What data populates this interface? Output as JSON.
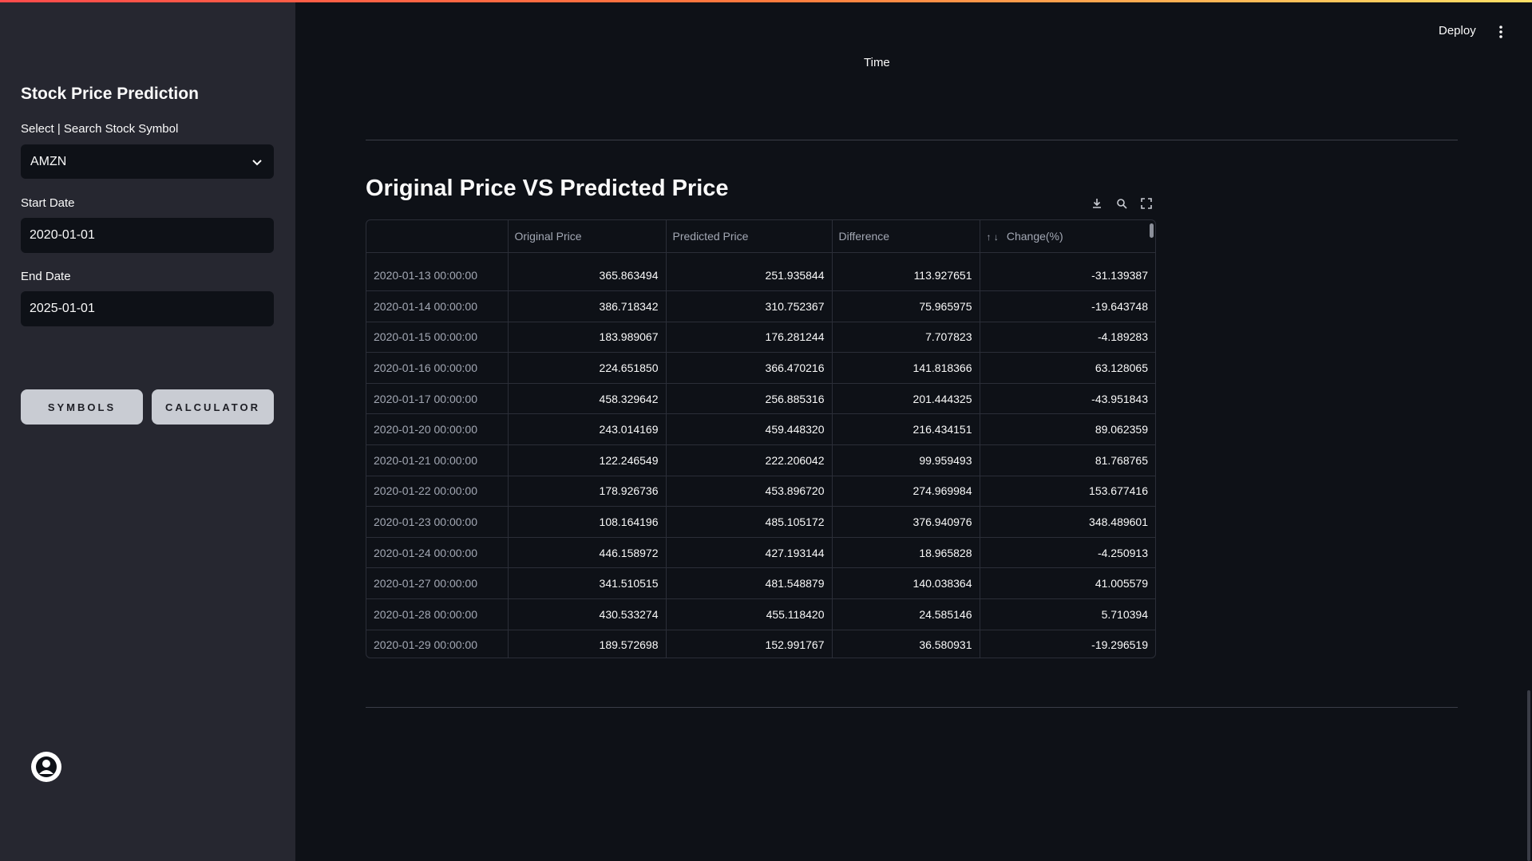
{
  "header": {
    "deploy_label": "Deploy",
    "menu_icon": "kebab-menu-icon"
  },
  "sidebar": {
    "title": "Stock Price Prediction",
    "symbol_label": "Select | Search Stock Symbol",
    "symbol_value": "AMZN",
    "start_date_label": "Start Date",
    "start_date_value": "2020-01-01",
    "end_date_label": "End Date",
    "end_date_value": "2025-01-01",
    "symbols_button": "SYMBOLS",
    "calculator_button": "CALCULATOR",
    "avatar_icon": "user-avatar-icon"
  },
  "main": {
    "axis_label": "Time",
    "section_title": "Original Price VS Predicted Price",
    "toolbar_icons": [
      "download-icon",
      "search-icon",
      "fullscreen-icon"
    ],
    "table": {
      "columns": [
        "",
        "Original Price",
        "Predicted Price",
        "Difference",
        "Change(%)"
      ],
      "rows": [
        [
          "2020-01-13 00:00:00",
          "365.863494",
          "251.935844",
          "113.927651",
          "-31.139387"
        ],
        [
          "2020-01-14 00:00:00",
          "386.718342",
          "310.752367",
          "75.965975",
          "-19.643748"
        ],
        [
          "2020-01-15 00:00:00",
          "183.989067",
          "176.281244",
          "7.707823",
          "-4.189283"
        ],
        [
          "2020-01-16 00:00:00",
          "224.651850",
          "366.470216",
          "141.818366",
          "63.128065"
        ],
        [
          "2020-01-17 00:00:00",
          "458.329642",
          "256.885316",
          "201.444325",
          "-43.951843"
        ],
        [
          "2020-01-20 00:00:00",
          "243.014169",
          "459.448320",
          "216.434151",
          "89.062359"
        ],
        [
          "2020-01-21 00:00:00",
          "122.246549",
          "222.206042",
          "99.959493",
          "81.768765"
        ],
        [
          "2020-01-22 00:00:00",
          "178.926736",
          "453.896720",
          "274.969984",
          "153.677416"
        ],
        [
          "2020-01-23 00:00:00",
          "108.164196",
          "485.105172",
          "376.940976",
          "348.489601"
        ],
        [
          "2020-01-24 00:00:00",
          "446.158972",
          "427.193144",
          "18.965828",
          "-4.250913"
        ],
        [
          "2020-01-27 00:00:00",
          "341.510515",
          "481.548879",
          "140.038364",
          "41.005579"
        ],
        [
          "2020-01-28 00:00:00",
          "430.533274",
          "455.118420",
          "24.585146",
          "5.710394"
        ],
        [
          "2020-01-29 00:00:00",
          "189.572698",
          "152.991767",
          "36.580931",
          "-19.296519"
        ]
      ]
    }
  },
  "colors": {
    "background": "#0e1117",
    "sidebar": "#262730",
    "button": "#c9ccd3",
    "accent_gradient_start": "#ff4b4b",
    "accent_gradient_end": "#ffe066"
  }
}
